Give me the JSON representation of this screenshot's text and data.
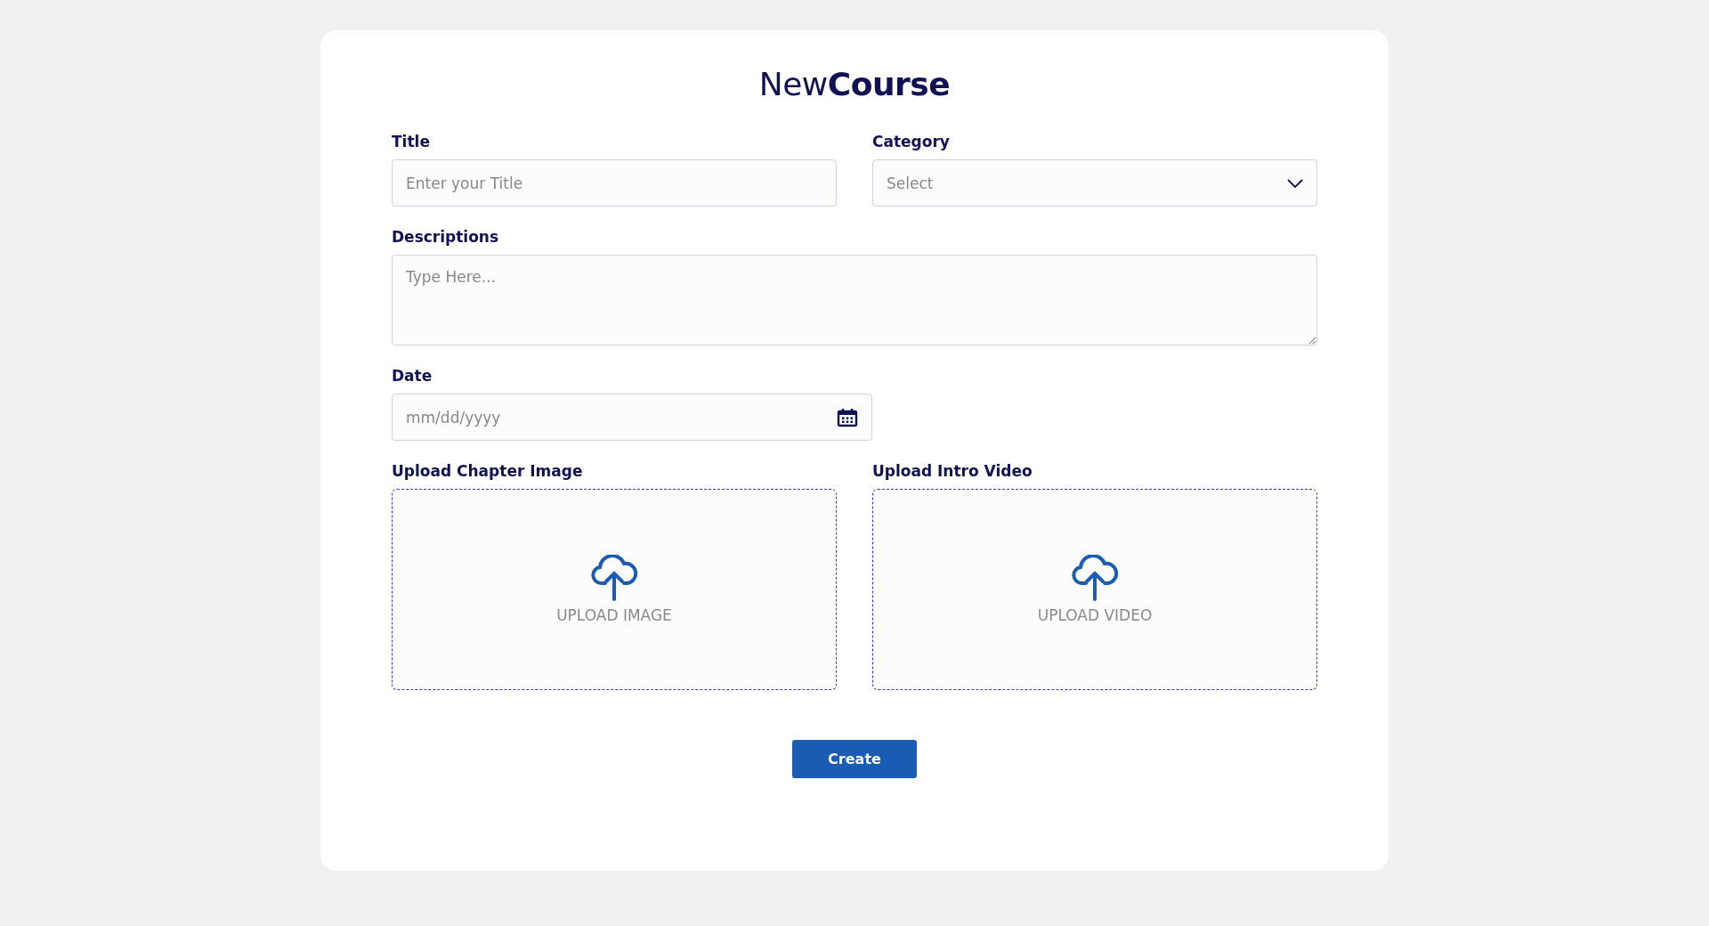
{
  "heading": "New**Course**",
  "title_field": {
    "label": "Title",
    "placeholder": "Enter your Title"
  },
  "category_field": {
    "label": "Category",
    "value": "Select"
  },
  "description_field": {
    "label": "Descriptions",
    "placeholder": "Type Here..."
  },
  "date_field": {
    "label": "Date",
    "placeholder": "mm/dd/yyyy"
  },
  "uploads": [
    {
      "label": "Upload Chapter Image",
      "text": "UPLOAD IMAGE"
    },
    {
      "label": "Upload Intro Video",
      "text": "UPLOAD VIDEO"
    }
  ],
  "submit_button": "Create"
}
